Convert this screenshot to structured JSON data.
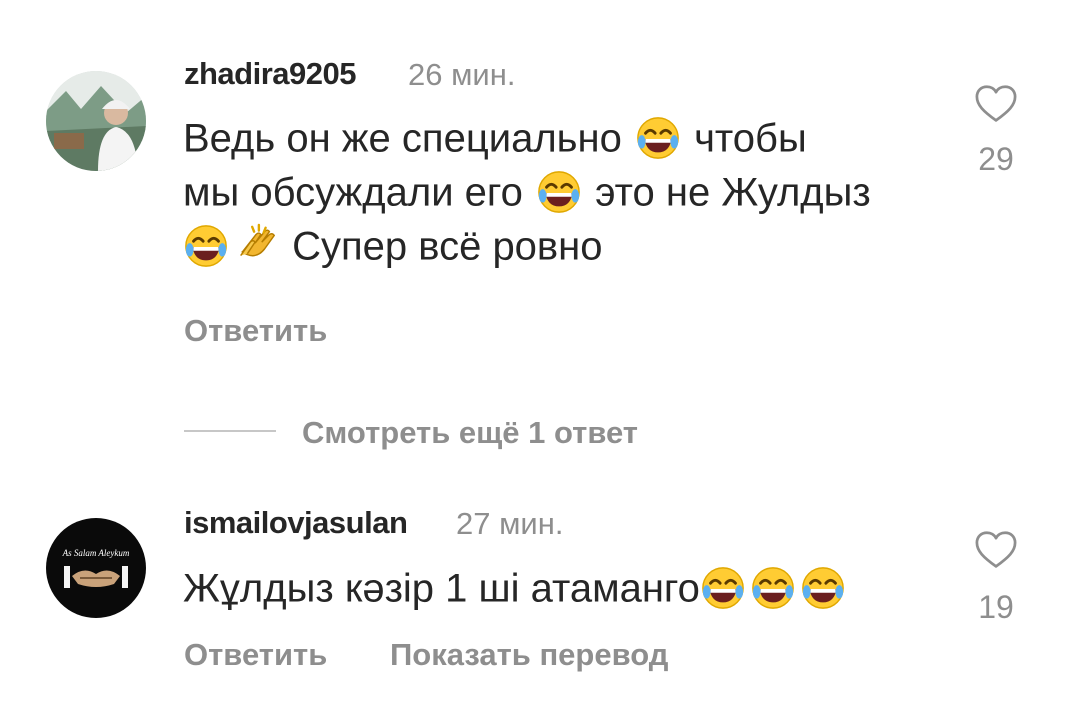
{
  "comments": [
    {
      "username": "zhadira9205",
      "time": "26 мин.",
      "lines": [
        "Ведь он же специально {e} чтобы",
        "мы обсуждали его {e} это не Жулдыз",
        "{e}{c} Супер всё ровно"
      ],
      "line1_a": "Ведь он же специально",
      "line1_b": "чтобы",
      "line2_a": "мы обсуждали его",
      "line2_b": "это не Жулдыз",
      "line3_b": "Супер всё ровно",
      "likes": "29",
      "reply_label": "Ответить",
      "avatar_icon": "user-photo-avatar"
    },
    {
      "username": "ismailovjasulan",
      "time": "27 мин.",
      "text": "Жұлдыз кәзір 1 ші атаманго",
      "likes": "19",
      "reply_label": "Ответить",
      "translate_label": "Показать перевод",
      "avatar_text": "As Salam Aleykum",
      "avatar_icon": "handshake-logo-avatar"
    }
  ],
  "view_more_replies": "Смотреть ещё 1 ответ",
  "emoji": {
    "laugh": "face-with-tears-of-joy-emoji",
    "clap": "clapping-hands-emoji"
  },
  "colors": {
    "text": "#262626",
    "secondary": "#8e8e8e",
    "emoji_yellow": "#ffcc33"
  }
}
